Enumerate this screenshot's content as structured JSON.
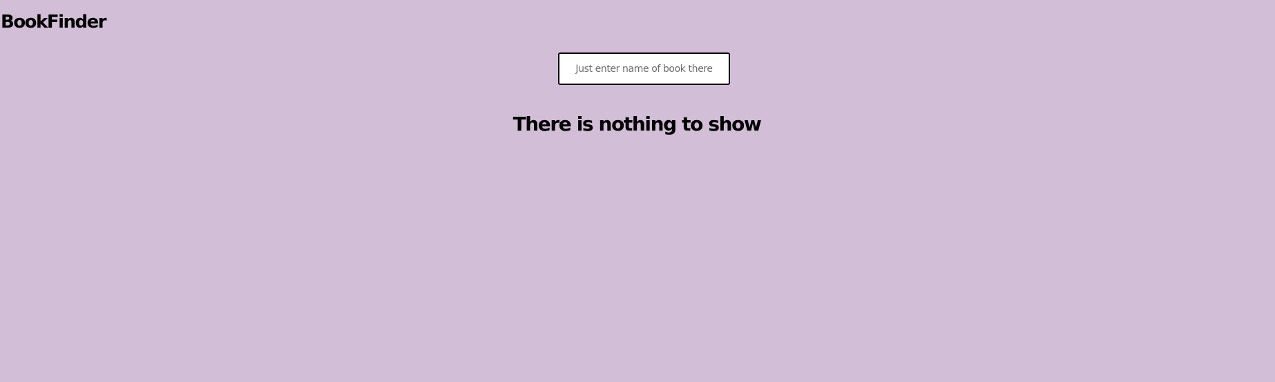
{
  "app": {
    "title": "BookFinder"
  },
  "search": {
    "value": "",
    "placeholder": "Just enter name of book there"
  },
  "results": {
    "empty_message": "There is nothing to show"
  },
  "colors": {
    "background": "#d2bed6",
    "text": "#000000",
    "input_background": "#ffffff",
    "input_border": "#000000"
  }
}
